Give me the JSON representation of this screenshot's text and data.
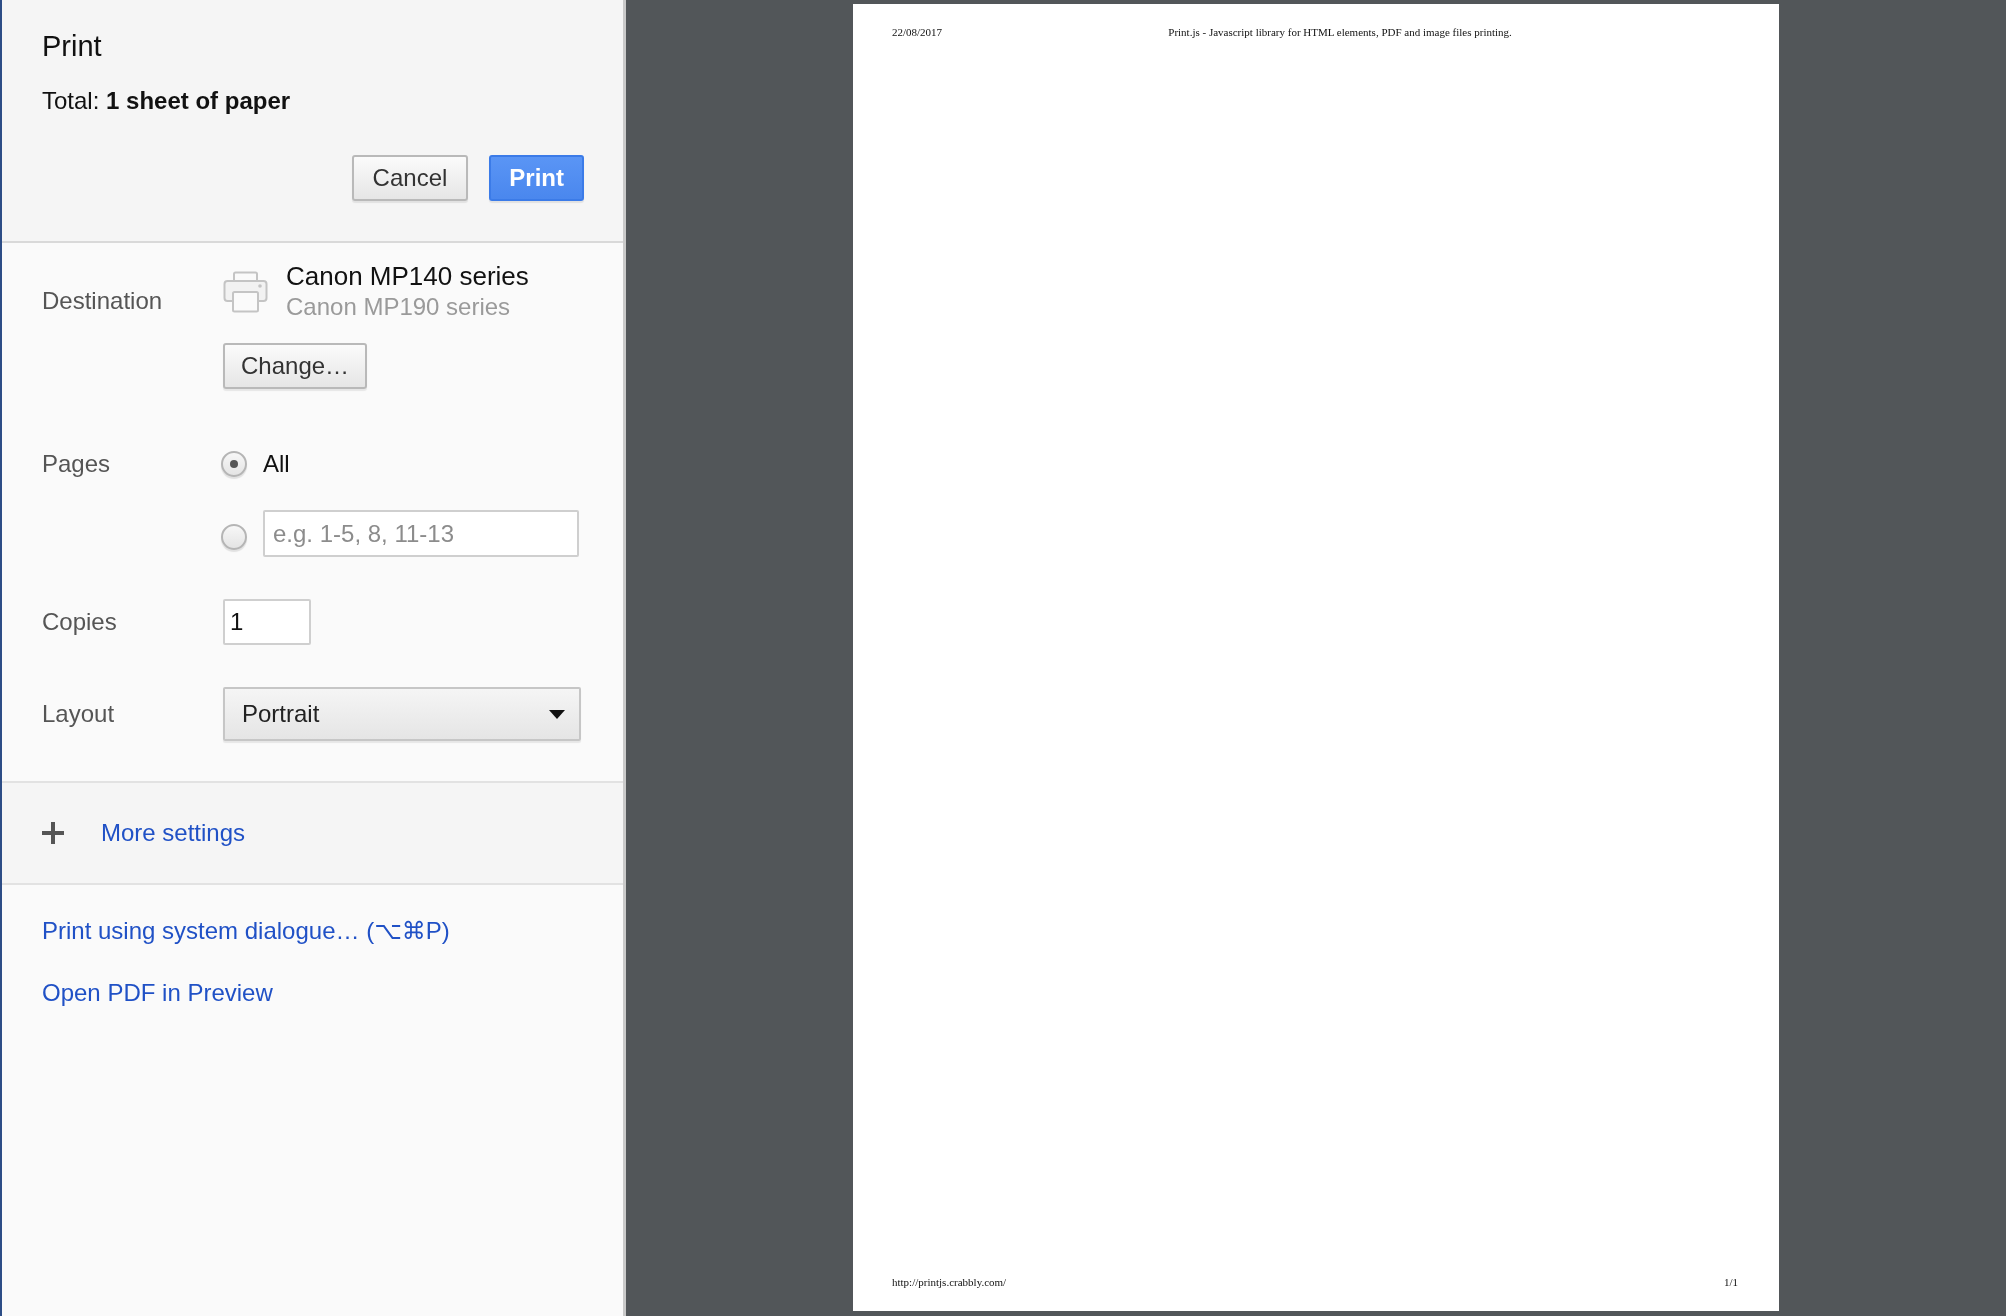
{
  "header": {
    "title": "Print",
    "total": "Total: **1 sheet of paper**",
    "buttons": [
      {
        "kind": "secondary",
        "label": "Cancel"
      },
      {
        "kind": "primary",
        "label": "Print"
      }
    ]
  },
  "destination": {
    "label": "Destination",
    "printer": "Canon MP140 series",
    "printer_detail": "Canon MP190 series",
    "change_button": "Change…"
  },
  "pages": {
    "label": "Pages",
    "options": [
      {
        "kind": "all",
        "label": "All",
        "selected": true
      },
      {
        "kind": "range",
        "placeholder": "e.g. 1-5, 8, 11-13",
        "selected": false
      }
    ]
  },
  "copies": {
    "label": "Copies",
    "value": "1"
  },
  "layout": {
    "label": "Layout",
    "value": "Portrait"
  },
  "more_settings": {
    "label": "More settings",
    "expanded": false
  },
  "links": [
    {
      "label": "Print using system dialogue… (⌥⌘P)"
    },
    {
      "label": "Open PDF in Preview"
    }
  ],
  "preview": {
    "header_left": "22/08/2017",
    "header_center": "Print.js - Javascript library for HTML elements, PDF and image files printing.",
    "footer_left": "http://printjs.crabbly.com/",
    "footer_right": "1/1"
  }
}
